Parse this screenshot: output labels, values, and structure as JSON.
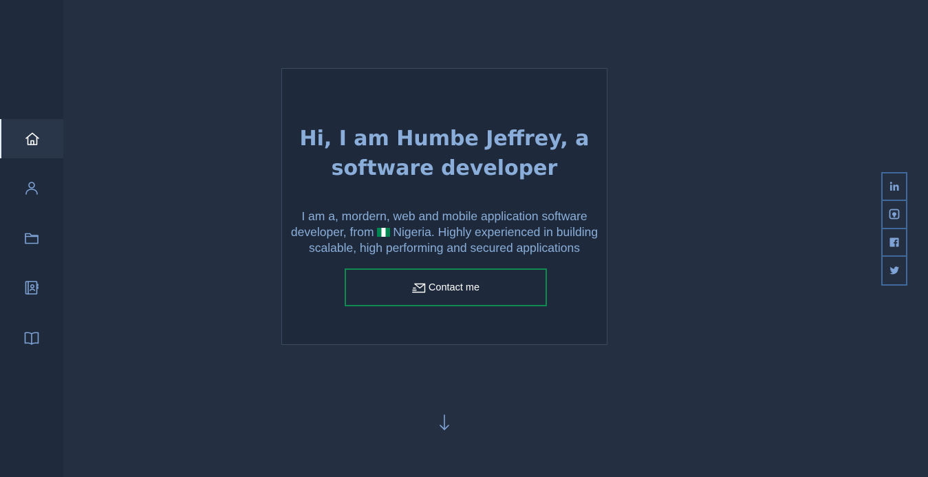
{
  "sidebar": {
    "items": [
      {
        "icon": "home-icon",
        "active": true
      },
      {
        "icon": "user-icon",
        "active": false
      },
      {
        "icon": "folder-icon",
        "active": false
      },
      {
        "icon": "contact-book-icon",
        "active": false
      },
      {
        "icon": "book-icon",
        "active": false
      }
    ]
  },
  "hero": {
    "heading": "Hi, I am Humbe Jeffrey, a software developer",
    "intro_before_flag": "I am a, mordern, web and mobile application software developer, from",
    "flag": "nigeria-flag-icon",
    "intro_after_flag": "Nigeria. Highly experienced in building scalable, high performing and secured applications",
    "contact_label": "Contact me",
    "contact_icon": "envelope-icon"
  },
  "scroll": {
    "icon": "arrow-down-icon"
  },
  "social": {
    "items": [
      "linkedin-icon",
      "github-icon",
      "facebook-icon",
      "twitter-icon"
    ]
  },
  "colors": {
    "background": "#243042",
    "sidebar": "#1f2b3d",
    "card": "#1e2a3c",
    "accent_text": "#8aaed9",
    "button_border": "#0f8a50",
    "social_border": "#3f6a9b"
  }
}
